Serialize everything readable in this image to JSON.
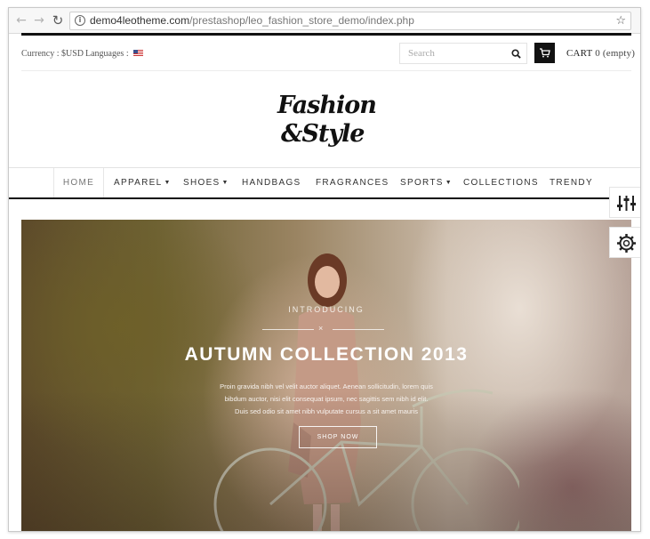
{
  "browser": {
    "url_domain": "demo4leotheme.com",
    "url_path": "/prestashop/leo_fashion_store_demo/index.php"
  },
  "topbar": {
    "currency_label": "Currency : $USD",
    "languages_label": "Languages :",
    "search_placeholder": "Search",
    "cart_label": "CART",
    "cart_status": "0 (empty)"
  },
  "logo": {
    "line1": "Fashion",
    "line2": "&Style"
  },
  "menu": {
    "items": [
      {
        "label": "HOME",
        "dropdown": false
      },
      {
        "label": "APPAREL",
        "dropdown": true
      },
      {
        "label": "SHOES",
        "dropdown": true
      },
      {
        "label": "HANDBAGS",
        "dropdown": false
      },
      {
        "label": "FRAGRANCES",
        "dropdown": false
      },
      {
        "label": "SPORTS",
        "dropdown": true
      },
      {
        "label": "COLLECTIONS",
        "dropdown": false
      },
      {
        "label": "TRENDY",
        "dropdown": false
      }
    ]
  },
  "hero": {
    "intro": "INTRODUCING",
    "title": "AUTUMN COLLECTION 2013",
    "desc_line1": "Proin gravida nibh vel velit auctor aliquet. Aenean sollicitudin, lorem quis",
    "desc_line2": "bibdum auctor, nisi elit consequat ipsum, nec sagittis sem nibh id elit.",
    "desc_line3": "Duis sed odio sit amet nibh vulputate cursus a sit amet mauris",
    "button": "SHOP NOW"
  },
  "colors": {
    "accent": "#111111",
    "menu_text": "#333333"
  }
}
